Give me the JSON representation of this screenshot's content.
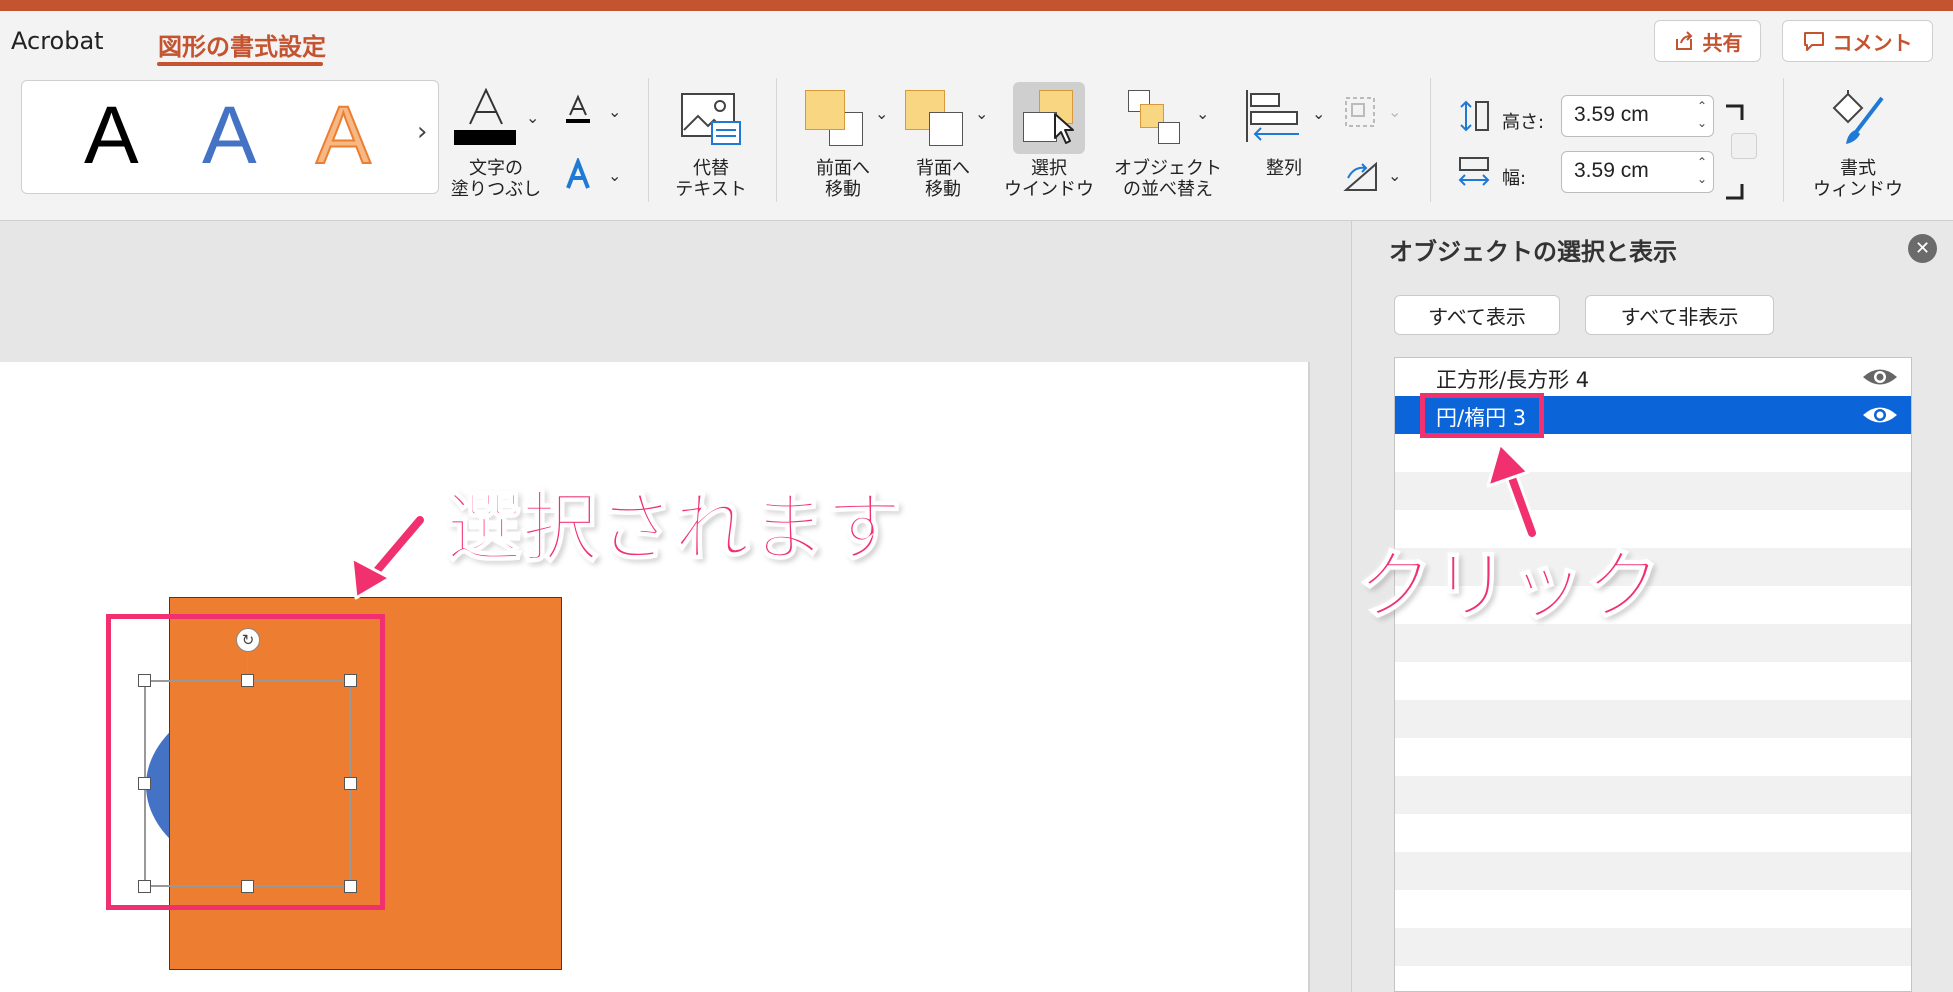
{
  "tabs": {
    "acrobat": "Acrobat",
    "shape_format": "図形の書式設定"
  },
  "top_buttons": {
    "share": "共有",
    "comment": "コメント"
  },
  "wordart": {
    "sample": "A"
  },
  "ribbon": {
    "text_fill": "文字の\n塗りつぶし",
    "alt_text": "代替\nテキスト",
    "bring_forward": "前面へ\n移動",
    "send_backward": "背面へ\n移動",
    "selection_pane": "選択\nウインドウ",
    "arrange_objects": "オブジェクト\nの並べ替え",
    "align": "整列",
    "format_pane": "書式\nウィンドウ"
  },
  "size": {
    "height_label": "高さ:",
    "height_value": "3.59 cm",
    "width_label": "幅:",
    "width_value": "3.59 cm"
  },
  "panel": {
    "title": "オブジェクトの選択と表示",
    "show_all": "すべて表示",
    "hide_all": "すべて非表示",
    "items": [
      {
        "label": "正方形/長方形 4",
        "selected": false
      },
      {
        "label": "円/楕円 3",
        "selected": true
      }
    ]
  },
  "annotations": {
    "selected_text": "選択されます",
    "click_text": "クリック"
  },
  "colors": {
    "accent": "#c4532f",
    "highlight_pink": "#f0306f",
    "selection_blue": "#0b64d8",
    "shape_orange": "#ed7d31",
    "shape_blue": "#4472c4"
  }
}
